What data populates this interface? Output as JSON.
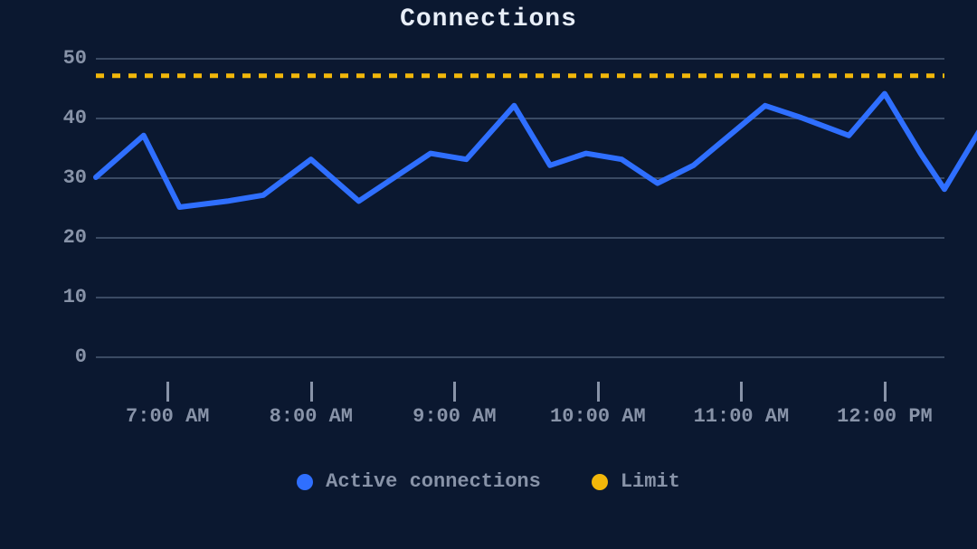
{
  "colors": {
    "active": "#2f6fff",
    "limit": "#f2b70a"
  },
  "title": "Connections",
  "legend": {
    "active": "Active connections",
    "limit": "Limit"
  },
  "y_ticks": [
    0,
    10,
    20,
    30,
    40,
    50
  ],
  "x_ticks": [
    "7:00 AM",
    "8:00 AM",
    "9:00 AM",
    "10:00 AM",
    "11:00 AM",
    "12:00 PM"
  ],
  "chart_data": {
    "type": "line",
    "title": "Connections",
    "xlabel": "",
    "ylabel": "",
    "ylim": [
      0,
      50
    ],
    "x_range_minutes": [
      390,
      745
    ],
    "x": [
      390,
      410,
      425,
      445,
      460,
      480,
      500,
      515,
      530,
      545,
      565,
      580,
      595,
      610,
      625,
      640,
      655,
      670,
      685,
      705,
      720,
      735,
      745
    ],
    "series": [
      {
        "name": "Active connections",
        "values": [
          30,
          37,
          25,
          26,
          27,
          33,
          26,
          30,
          34,
          33,
          42,
          32,
          34,
          33,
          29,
          32,
          37,
          42,
          40,
          37,
          44,
          34,
          28
        ]
      },
      {
        "name": "Limit",
        "values": [
          47,
          47,
          47,
          47,
          47,
          47,
          47,
          47,
          47,
          47,
          47,
          47,
          47,
          47,
          47,
          47,
          47,
          47,
          47,
          47,
          47,
          47,
          47
        ]
      }
    ],
    "x_tick_labels": [
      "7:00 AM",
      "8:00 AM",
      "9:00 AM",
      "10:00 AM",
      "11:00 AM",
      "12:00 PM"
    ],
    "x_tick_minutes": [
      420,
      480,
      540,
      600,
      660,
      720
    ],
    "y_ticks": [
      0,
      10,
      20,
      30,
      40,
      50
    ]
  }
}
